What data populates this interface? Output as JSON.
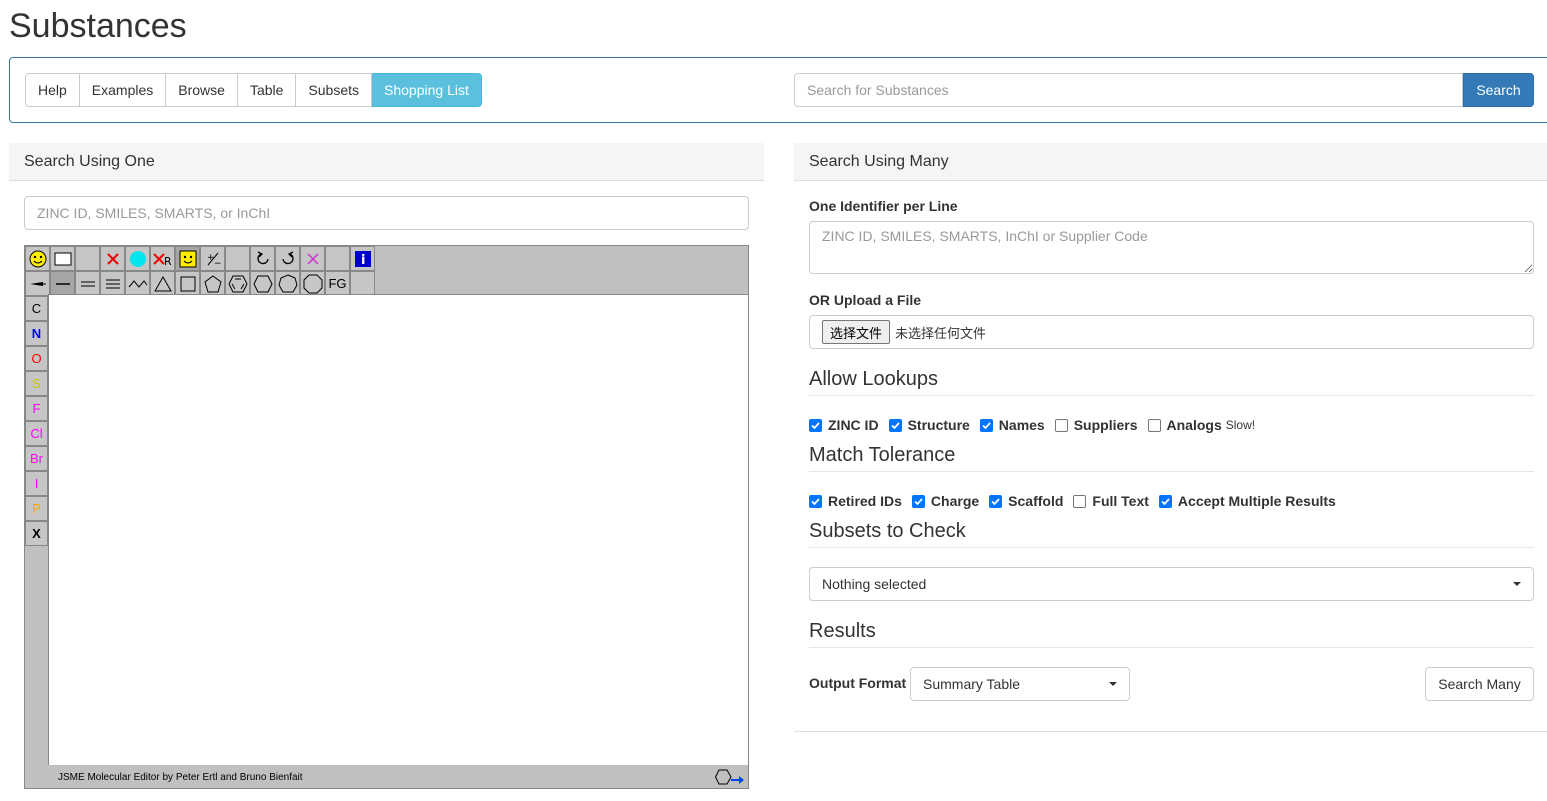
{
  "page_title": "Substances",
  "nav": {
    "tabs": [
      "Help",
      "Examples",
      "Browse",
      "Table",
      "Subsets",
      "Shopping List"
    ],
    "active_tab": "Shopping List",
    "search_placeholder": "Search for Substances",
    "search_button": "Search"
  },
  "search_one": {
    "header": "Search Using One",
    "input_placeholder": "ZINC ID, SMILES, SMARTS, or InChI",
    "editor": {
      "side_atoms": [
        {
          "label": "C",
          "color": "#000000"
        },
        {
          "label": "N",
          "color": "#0000ff"
        },
        {
          "label": "O",
          "color": "#ff0000"
        },
        {
          "label": "S",
          "color": "#c8c800"
        },
        {
          "label": "F",
          "color": "#ff00ff"
        },
        {
          "label": "Cl",
          "color": "#ff00ff"
        },
        {
          "label": "Br",
          "color": "#ff00ff"
        },
        {
          "label": "I",
          "color": "#ff00ff"
        },
        {
          "label": "P",
          "color": "#ffa500"
        },
        {
          "label": "X",
          "color": "#000000"
        }
      ],
      "fg_label": "FG",
      "credit": "JSME Molecular Editor by Peter Ertl and Bruno Bienfait"
    }
  },
  "search_many": {
    "header": "Search Using Many",
    "identifier_label": "One Identifier per Line",
    "textarea_placeholder": "ZINC ID, SMILES, SMARTS, InChI or Supplier Code",
    "upload_label": "OR Upload a File",
    "file_button": "选择文件",
    "file_status": "未选择任何文件",
    "allow_lookups": {
      "title": "Allow Lookups",
      "options": [
        {
          "label": "ZINC ID",
          "checked": true
        },
        {
          "label": "Structure",
          "checked": true
        },
        {
          "label": "Names",
          "checked": true
        },
        {
          "label": "Suppliers",
          "checked": false
        },
        {
          "label": "Analogs",
          "checked": false,
          "note": "Slow!"
        }
      ]
    },
    "match_tolerance": {
      "title": "Match Tolerance",
      "options": [
        {
          "label": "Retired IDs",
          "checked": true
        },
        {
          "label": "Charge",
          "checked": true
        },
        {
          "label": "Scaffold",
          "checked": true
        },
        {
          "label": "Full Text",
          "checked": false
        },
        {
          "label": "Accept Multiple Results",
          "checked": true
        }
      ]
    },
    "subsets": {
      "title": "Subsets to Check",
      "selected": "Nothing selected"
    },
    "results": {
      "title": "Results",
      "output_label": "Output Format",
      "output_value": "Summary Table",
      "search_button": "Search Many"
    }
  }
}
